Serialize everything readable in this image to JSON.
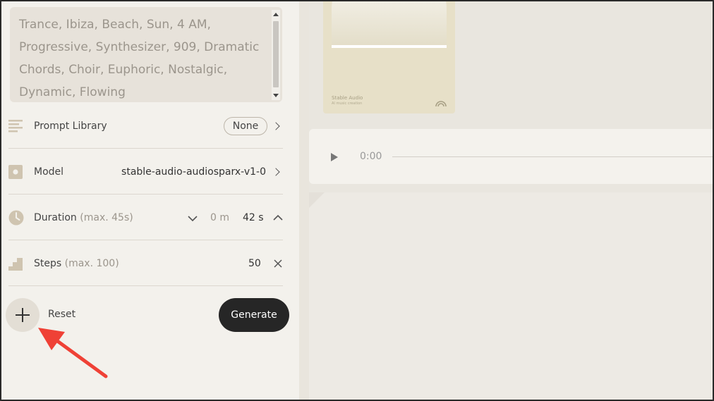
{
  "prompt": {
    "text": "Trance, Ibiza, Beach, Sun, 4 AM, Progressive, Synthesizer, 909, Dramatic Chords, Choir, Euphoric, Nostalgic, Dynamic, Flowing"
  },
  "settings": {
    "prompt_library": {
      "label": "Prompt Library",
      "value": "None",
      "icon": "list-lines-icon"
    },
    "model": {
      "label": "Model",
      "value": "stable-audio-audiosparx-v1-0",
      "icon": "square-dot-icon"
    },
    "duration": {
      "label": "Duration",
      "hint": "(max. 45s)",
      "minutes": "0 m",
      "seconds": "42 s",
      "icon": "clock-icon"
    },
    "steps": {
      "label": "Steps",
      "hint": "(max. 100)",
      "value": "50",
      "icon": "stairs-icon"
    }
  },
  "actions": {
    "add_icon": "plus-icon",
    "reset_label": "Reset",
    "generate_label": "Generate"
  },
  "cover": {
    "title": "Stable Audio",
    "subtitle": "AI music creation"
  },
  "player": {
    "time": "0:00"
  },
  "colors": {
    "background": "#f3f1ec",
    "accent_dark": "#262626",
    "icon_tan": "#cfc4b0",
    "annotation_arrow": "#ef4136"
  }
}
